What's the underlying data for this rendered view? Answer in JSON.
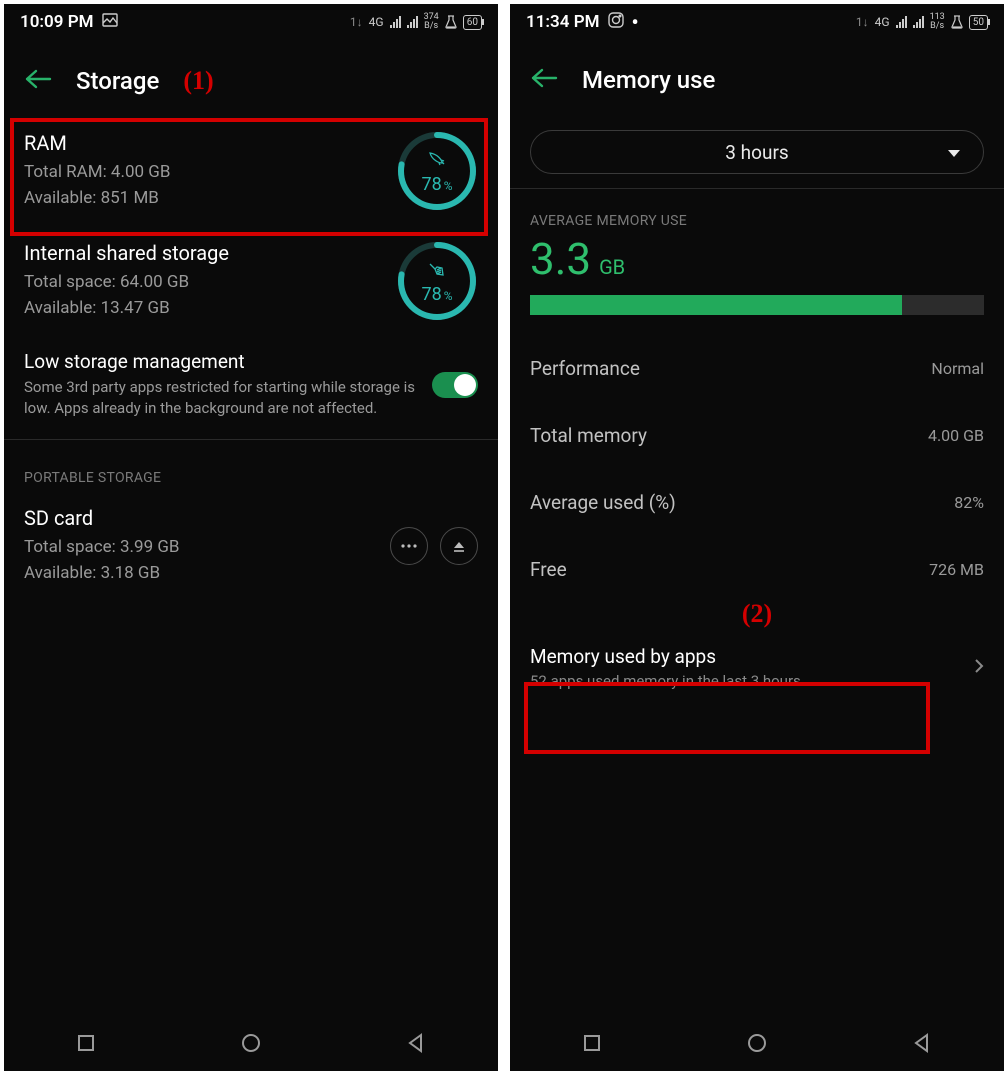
{
  "left": {
    "status": {
      "time": "10:09 PM",
      "net": "4G",
      "rate_num": "374",
      "rate_unit": "B/s",
      "battery": "60"
    },
    "title": "Storage",
    "annot": "(1)",
    "ram": {
      "title": "RAM",
      "line1": "Total RAM: 4.00 GB",
      "line2": "Available: 851 MB",
      "pct": "78",
      "pct_suffix": "%"
    },
    "internal": {
      "title": "Internal shared storage",
      "line1": "Total space: 64.00 GB",
      "line2": "Available: 13.47 GB",
      "pct": "78",
      "pct_suffix": "%"
    },
    "lowstorage": {
      "title": "Low storage management",
      "desc": "Some 3rd party apps restricted for starting while storage is low. Apps already in the background are not affected."
    },
    "portable_label": "PORTABLE STORAGE",
    "sd": {
      "title": "SD card",
      "line1": "Total space: 3.99 GB",
      "line2": "Available: 3.18 GB"
    }
  },
  "right": {
    "status": {
      "time": "11:34 PM",
      "net": "4G",
      "rate_num": "113",
      "rate_unit": "B/s",
      "battery": "50"
    },
    "title": "Memory use",
    "dropdown": "3 hours",
    "avg_label": "AVERAGE MEMORY USE",
    "avg_num": "3.3",
    "avg_unit": "GB",
    "bar_pct": 82,
    "rows": {
      "performance_k": "Performance",
      "performance_v": "Normal",
      "total_k": "Total memory",
      "total_v": "4.00 GB",
      "avgused_k": "Average used (%)",
      "avgused_v": "82%",
      "free_k": "Free",
      "free_v": "726 MB"
    },
    "annot": "(2)",
    "apps": {
      "title": "Memory used by apps",
      "sub": "52 apps used memory in the last 3 hours"
    }
  }
}
